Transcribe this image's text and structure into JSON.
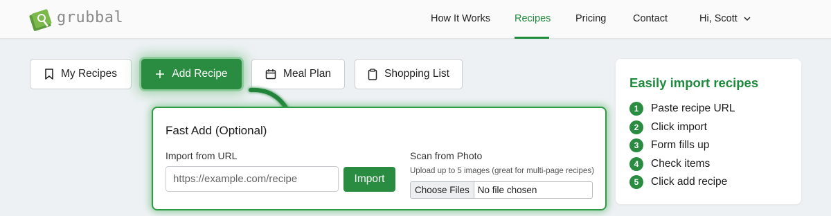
{
  "brand": {
    "name": "grubbal",
    "color": "#2a8c41"
  },
  "nav": {
    "items": [
      {
        "label": "How It Works",
        "active": false
      },
      {
        "label": "Recipes",
        "active": true
      },
      {
        "label": "Pricing",
        "active": false
      },
      {
        "label": "Contact",
        "active": false
      }
    ],
    "user_label": "Hi, Scott"
  },
  "tabs": [
    {
      "label": "My Recipes",
      "icon": "bookmark-icon",
      "active": false
    },
    {
      "label": "Add Recipe",
      "icon": "plus-icon",
      "active": true
    },
    {
      "label": "Meal Plan",
      "icon": "calendar-icon",
      "active": false
    },
    {
      "label": "Shopping List",
      "icon": "clipboard-icon",
      "active": false
    }
  ],
  "fast_add": {
    "title": "Fast Add (Optional)",
    "url_label": "Import from URL",
    "url_placeholder": "https://example.com/recipe",
    "url_value": "",
    "import_label": "Import",
    "scan_label": "Scan from Photo",
    "scan_hint": "Upload up to 5 images (great for multi-page recipes)",
    "choose_files_label": "Choose Files",
    "file_status": "No file chosen"
  },
  "info_card": {
    "title": "Easily import recipes",
    "steps": [
      {
        "num": "1",
        "text": "Paste recipe URL"
      },
      {
        "num": "2",
        "text": "Click import"
      },
      {
        "num": "3",
        "text": "Form fills up"
      },
      {
        "num": "4",
        "text": "Check items"
      },
      {
        "num": "5",
        "text": "Click add recipe"
      }
    ]
  },
  "colors": {
    "accent": "#2a8c41",
    "accent_text": "#1e8a3c",
    "background": "#eef1f4"
  }
}
